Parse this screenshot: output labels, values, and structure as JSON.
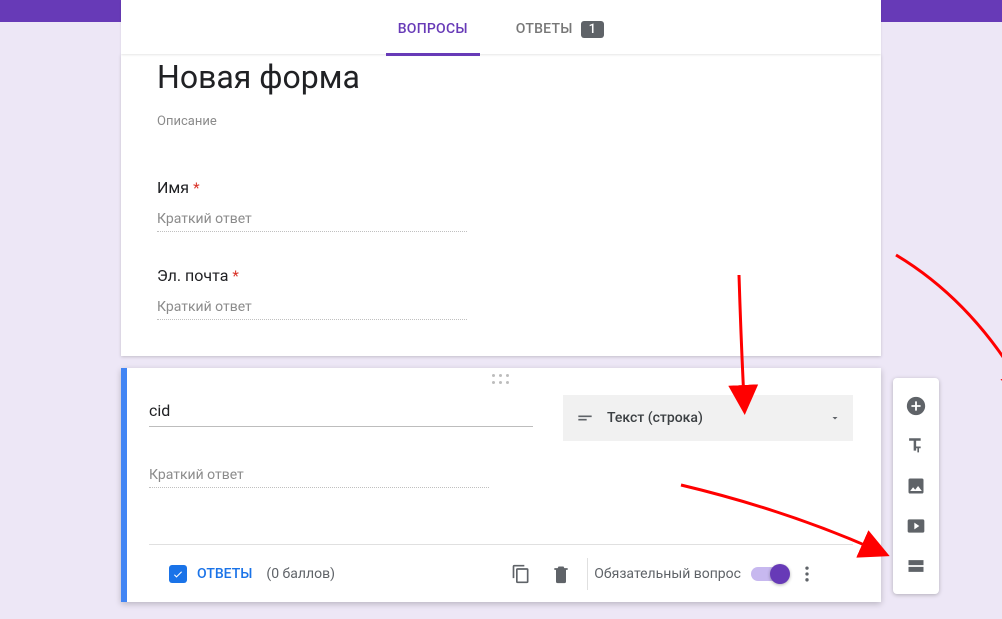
{
  "tabs": {
    "questions": "ВОПРОСЫ",
    "answers": "ОТВЕТЫ",
    "answers_badge": "1"
  },
  "form": {
    "title": "Новая форма",
    "description": "Описание"
  },
  "questions": [
    {
      "title": "Имя",
      "required": true,
      "answer_ph": "Краткий ответ"
    },
    {
      "title": "Эл. почта",
      "required": true,
      "answer_ph": "Краткий ответ"
    }
  ],
  "active": {
    "title": "cid",
    "answer_ph": "Краткий ответ",
    "type_label": "Текст (строка)",
    "answers_label": "ОТВЕТЫ",
    "points": "(0 баллов)",
    "required_label": "Обязательный вопрос",
    "required_on": true
  }
}
